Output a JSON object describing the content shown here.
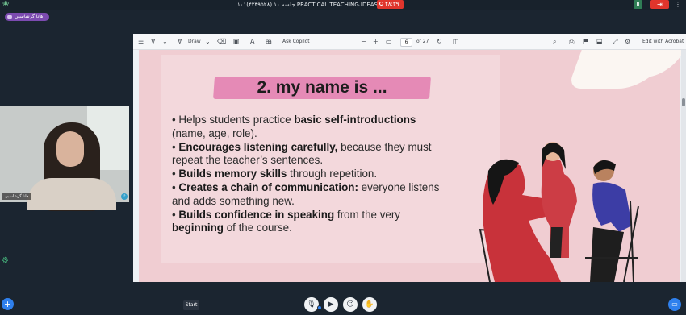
{
  "topbar": {
    "meeting_title": "۱۰۱(۴۲۴۹۵۲۸) جلسه ۱۰ PRACTICAL TEACHING IDEAS",
    "title_chevron_icon": "chevron-down-icon",
    "timer": "۴۸:۳۹",
    "signal_icon": "signal-bars-icon",
    "leave_icon": "exit-icon",
    "more_icon": "more-vertical-icon"
  },
  "user_badge": {
    "name": "هانا گرشاسبی"
  },
  "webcam": {
    "name_label": "هانا گرشاسبی"
  },
  "pdf_toolbar": {
    "draw": "Draw",
    "ask_copilot": "Ask Copilot",
    "zoom_out": "−",
    "zoom_in": "+",
    "page_current": "6",
    "page_total": "of 27",
    "edit_acrobat": "Edit with Acrobat"
  },
  "slide": {
    "title": "2. my name is ...",
    "bullets": [
      {
        "prefix": "• Helps students practice ",
        "bold": "basic self-introductions",
        "rest": ""
      },
      {
        "prefix": "",
        "bold": "",
        "rest": "(name, age, role)."
      },
      {
        "prefix": " • ",
        "bold": "Encourages listening carefully,",
        "rest": " because they must"
      },
      {
        "prefix": "",
        "bold": "",
        "rest": "repeat the teacher’s sentences."
      },
      {
        "prefix": " • ",
        "bold": "Builds memory skills",
        "rest": " through repetition."
      },
      {
        "prefix": " • ",
        "bold": "Creates a chain of communication:",
        "rest": " everyone listens"
      },
      {
        "prefix": "",
        "bold": "",
        "rest": "and adds something new."
      },
      {
        "prefix": " • ",
        "bold": "Builds confidence in speaking",
        "rest": " from the very"
      },
      {
        "prefix": "",
        "bold": "beginning",
        "rest": " of the course."
      }
    ]
  },
  "bottombar": {
    "start_tooltip": "Start",
    "controls": [
      "microphone-icon",
      "camera-icon",
      "emoji-icon",
      "raise-hand-icon"
    ]
  },
  "colors": {
    "title_highlight": "#e58ab6",
    "slide_bg": "#f0cdd2",
    "recording": "#e0352c",
    "accent_blue": "#2f80ed"
  }
}
